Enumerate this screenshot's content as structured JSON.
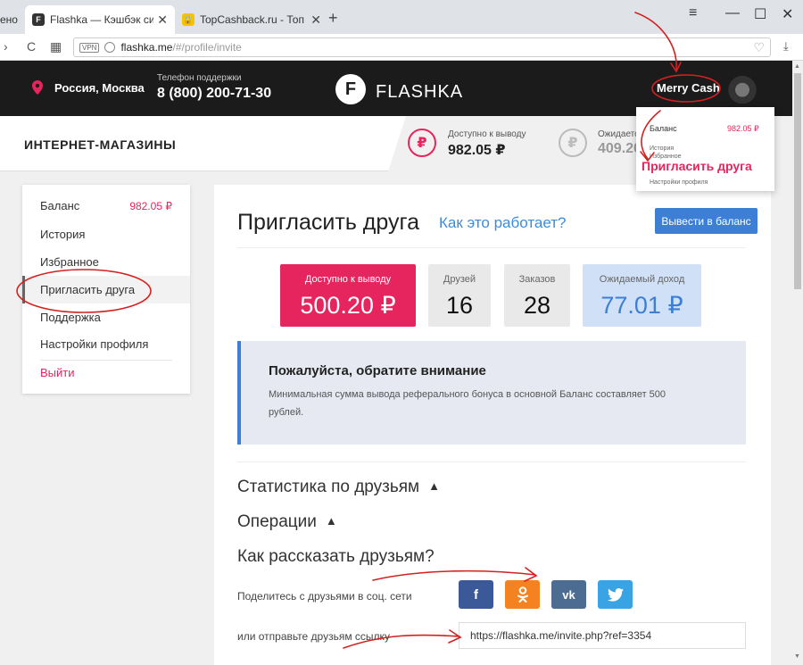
{
  "browser": {
    "tabs": [
      {
        "title": "ено"
      },
      {
        "title": "Flashka — Кэшбэк систем"
      },
      {
        "title": "TopCashback.ru - Топ лучш"
      }
    ],
    "url_domain": "flashka.me",
    "url_path": "/#/profile/invite",
    "vpn_label": "VPN"
  },
  "header": {
    "city": "Россия, Москва",
    "support_label": "Телефон поддержки",
    "support_phone": "8 (800) 200-71-30",
    "logo_text": "FLASHKA",
    "username": "Merry Cash"
  },
  "subheader": {
    "title": "ИНТЕРНЕТ-МАГАЗИНЫ",
    "available_label": "Доступно к выводу",
    "available_value": "982.05 ₽",
    "expected_label": "Ожидаетс",
    "expected_value": "409.20"
  },
  "dropdown": {
    "balance_label": "Баланс",
    "balance_value": "982.05 ₽",
    "history": "История",
    "favorites": "Избранное",
    "invite": "Пригласить друга",
    "settings": "Настройки профиля"
  },
  "sidebar": {
    "balance_label": "Баланс",
    "balance_value": "982.05 ₽",
    "items": [
      "История",
      "Избранное",
      "Пригласить друга",
      "Поддержка",
      "Настройки профиля"
    ],
    "logout": "Выйти"
  },
  "main": {
    "title": "Пригласить друга",
    "how_link": "Как это работает?",
    "withdraw_button": "Вывести в баланс",
    "cards": {
      "available_label": "Доступно к выводу",
      "available_value": "500.20 ₽",
      "friends_label": "Друзей",
      "friends_value": "16",
      "orders_label": "Заказов",
      "orders_value": "28",
      "expected_label": "Ожидаемый доход",
      "expected_value": "77.01 ₽"
    },
    "notice_title": "Пожалуйста, обратите внимание",
    "notice_text": "Минимальная сумма вывода реферального бонуса в основной Баланс составляет 500 рублей.",
    "stats_section": "Статистика по друзьям",
    "operations_section": "Операции",
    "share_section": "Как рассказать друзьям?",
    "share_label": "Поделитесь с друзьями в соц. сети",
    "link_label": "или отправьте друзьям ссылку",
    "invite_link": "https://flashka.me/invite.php?ref=3354",
    "social": {
      "facebook": "f",
      "odnoklassniki": "ok",
      "vk": "vk",
      "twitter": "tw"
    }
  },
  "colors": {
    "accent_pink": "#e6245e",
    "accent_blue": "#3c7fd4",
    "facebook": "#3b5998",
    "odnoklassniki": "#f58220",
    "vk": "#4c6c91",
    "twitter": "#3aa3e3"
  }
}
